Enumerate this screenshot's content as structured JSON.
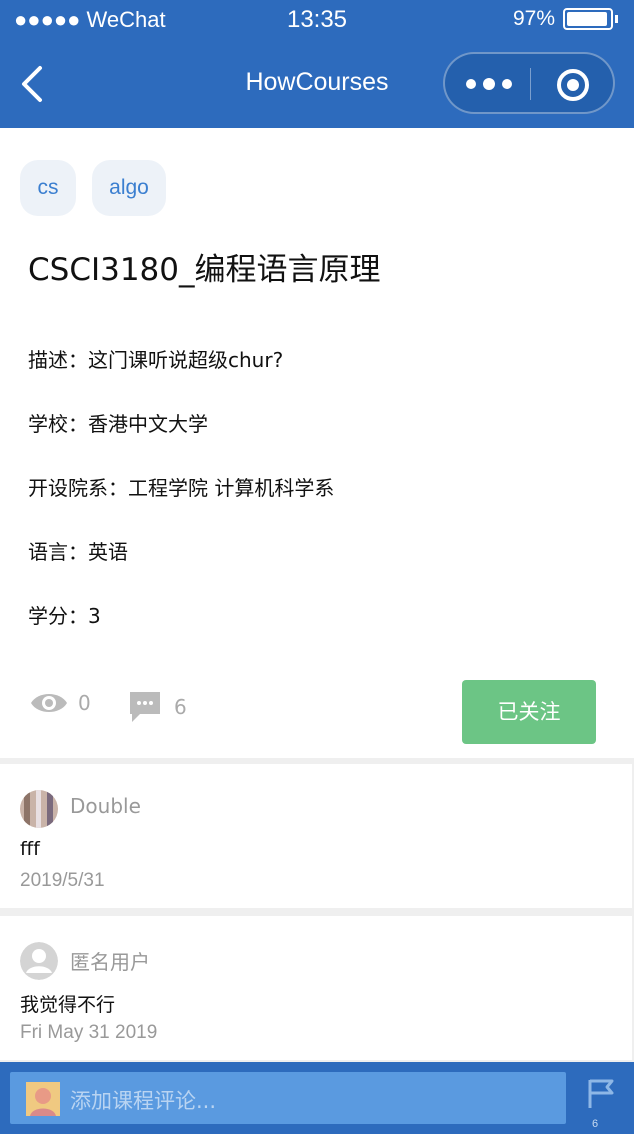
{
  "status_bar": {
    "carrier": "●●●●● WeChat",
    "time": "13:35",
    "battery": "97%"
  },
  "nav": {
    "title": "HowCourses"
  },
  "tags": [
    "cs",
    "algo"
  ],
  "course": {
    "title": "CSCI3180_编程语言原理",
    "description": "描述：这门课听说超级chur?",
    "school": "学校：香港中文大学",
    "department": "开设院系：工程学院 计算机科学系",
    "language": "语言：英语",
    "credits": "学分：3"
  },
  "stats": {
    "views": "0",
    "comments": "6"
  },
  "follow_button": "已关注",
  "comments": [
    {
      "name": "Double",
      "text": "fff",
      "date": "2019/5/31"
    },
    {
      "name": "匿名用户",
      "text": "我觉得不行",
      "date": "Fri May 31 2019"
    }
  ],
  "input": {
    "placeholder": "添加课程评论..."
  },
  "flag_count": "6",
  "colors": {
    "brand": "#2d6bbd",
    "tag_text": "#3b7fd0",
    "follow": "#6cc585"
  }
}
